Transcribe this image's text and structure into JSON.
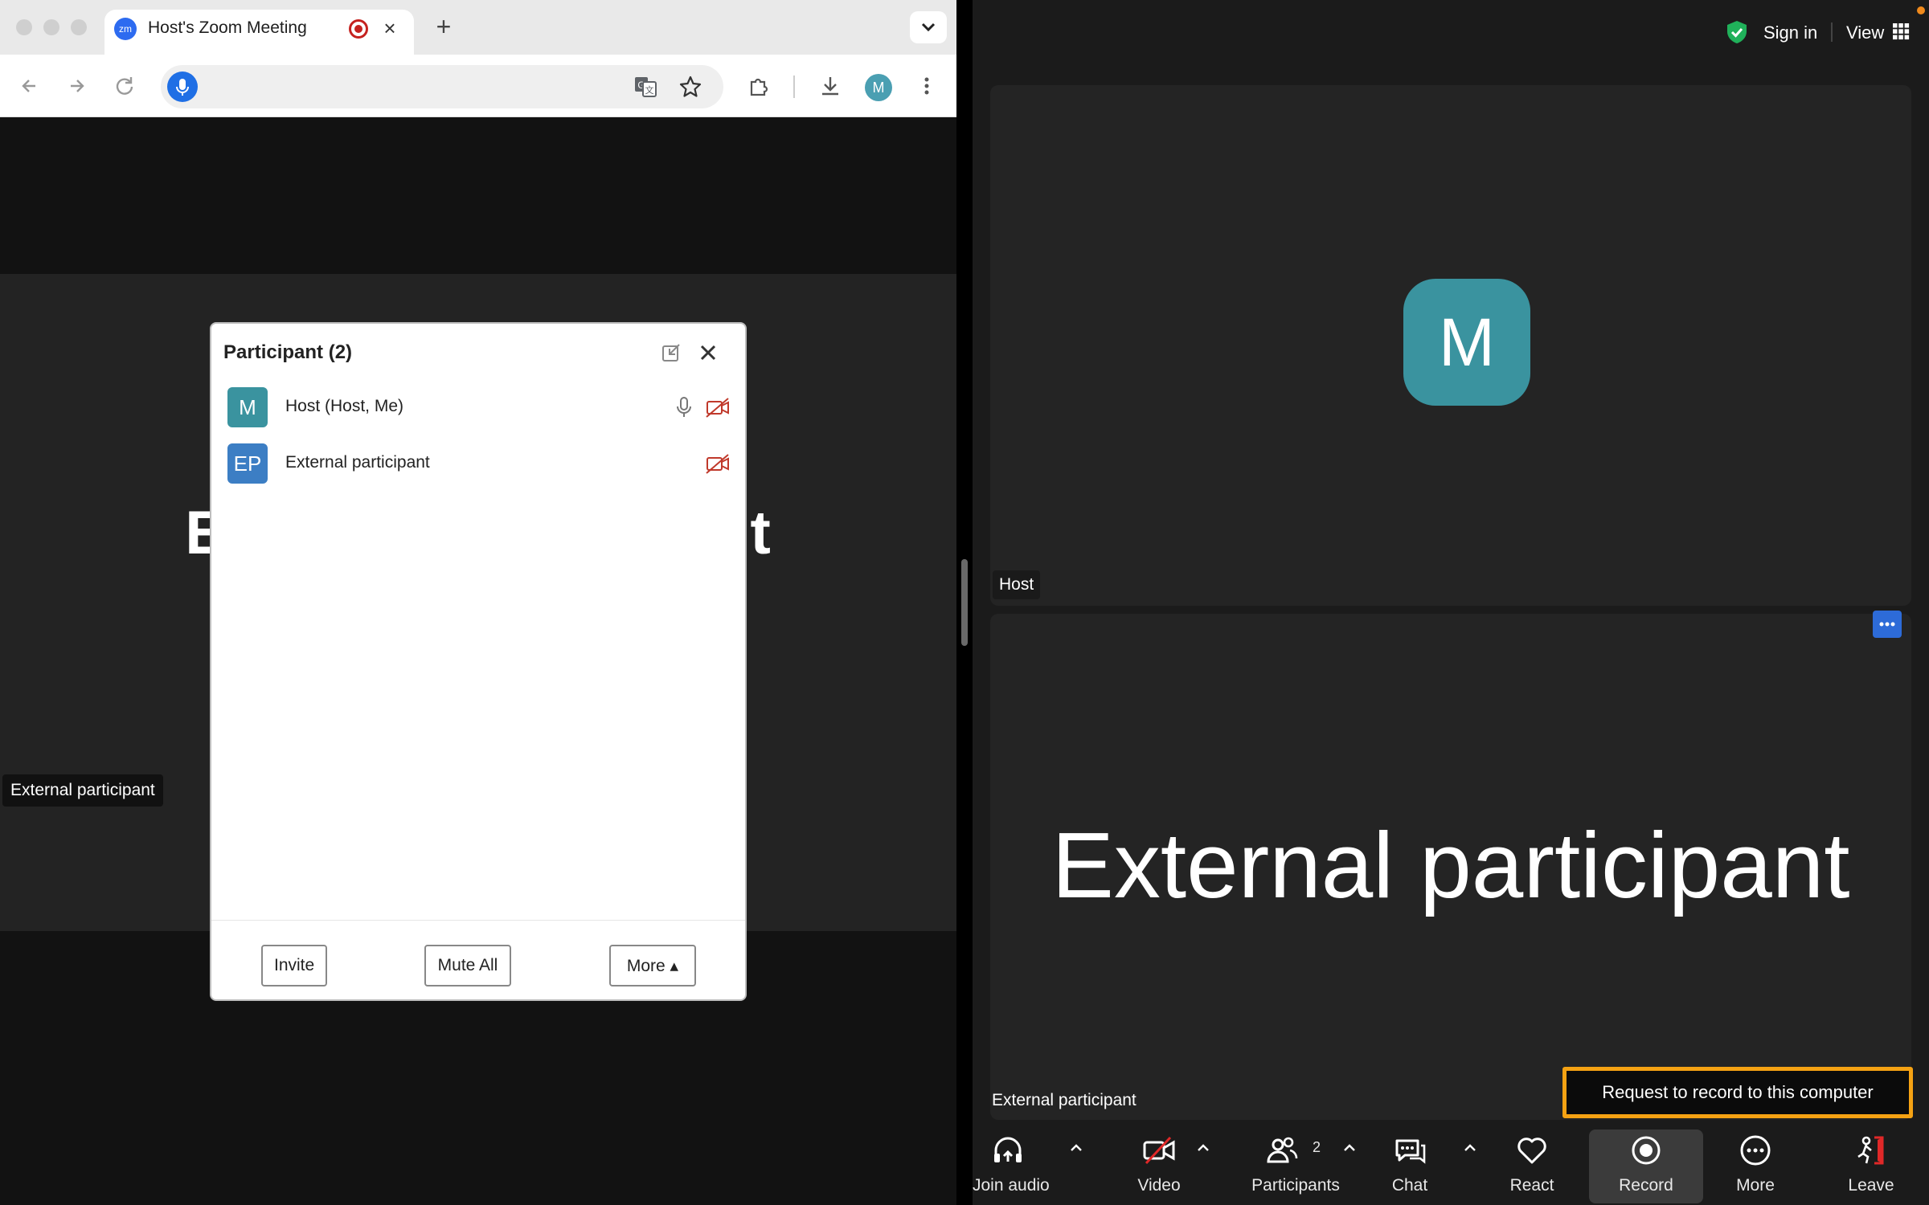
{
  "browser": {
    "tab": {
      "favicon": "zm",
      "title": "Host's Zoom Meeting"
    },
    "toolbar": {
      "address_value": "",
      "profile_initial": "M"
    },
    "background": {
      "speaker_name": "External participant",
      "tile_label": "External participant"
    }
  },
  "participants_panel": {
    "title": "Participant (2)",
    "participants": [
      {
        "initials": "M",
        "name": "Host (Host, Me)",
        "avatar_color": "#3a939f",
        "mic": true,
        "video_off": true
      },
      {
        "initials": "EP",
        "name": "External participant",
        "avatar_color": "#3c7ec4",
        "mic": false,
        "video_off": true
      }
    ],
    "footer": {
      "invite": "Invite",
      "mute_all": "Mute All",
      "more": "More ▴"
    }
  },
  "zoom": {
    "top": {
      "sign_in": "Sign in",
      "view": "View"
    },
    "host_tile": {
      "avatar_initial": "M",
      "label": "Host"
    },
    "ext_tile": {
      "big_name": "External participant",
      "label": "External participant"
    },
    "record_request": "Request to record to this computer",
    "controls": {
      "join_audio": "Join audio",
      "video": "Video",
      "participants": "Participants",
      "participants_count": "2",
      "chat": "Chat",
      "react": "React",
      "record": "Record",
      "more": "More",
      "leave": "Leave"
    }
  },
  "colors": {
    "accent": "#f5a213",
    "brand": "#2d6bf0",
    "avatar_teal": "#3a939f",
    "leave_red": "#e02828"
  }
}
